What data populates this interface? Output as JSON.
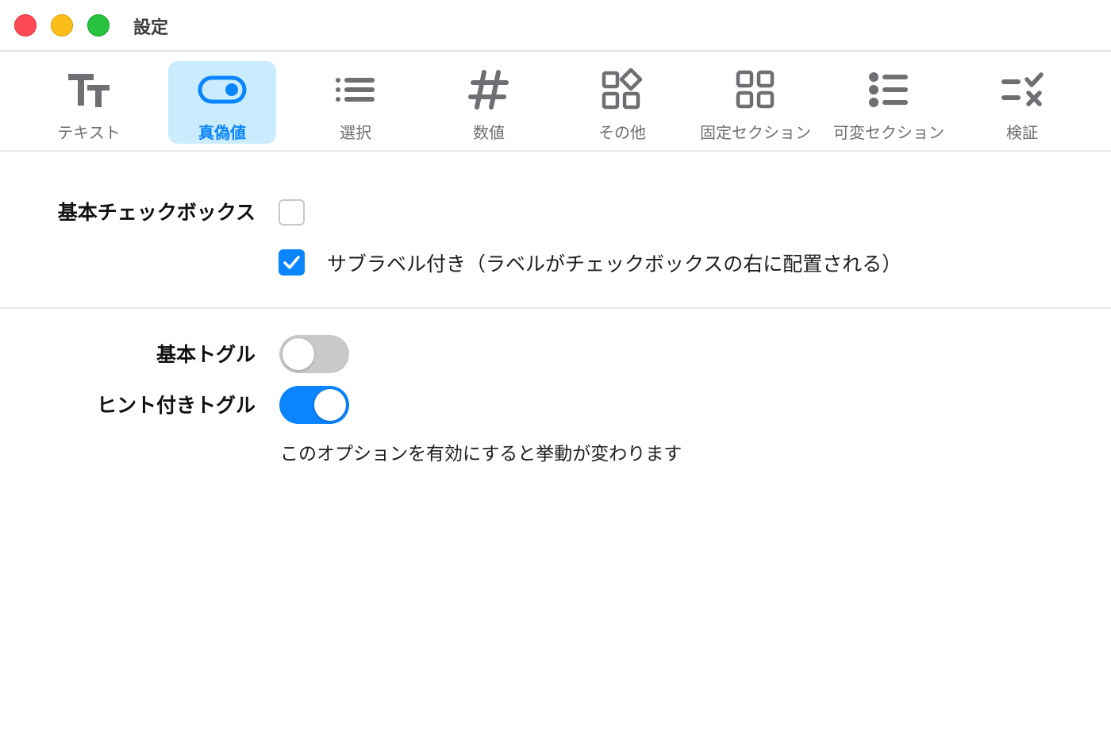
{
  "window": {
    "title": "設定"
  },
  "toolbar": {
    "items": [
      {
        "label": "テキスト",
        "icon": "text-format-icon",
        "active": false
      },
      {
        "label": "真偽値",
        "icon": "toggle-icon",
        "active": true
      },
      {
        "label": "選択",
        "icon": "list-icon",
        "active": false
      },
      {
        "label": "数値",
        "icon": "hashtag-icon",
        "active": false
      },
      {
        "label": "その他",
        "icon": "shapes-icon",
        "active": false
      },
      {
        "label": "固定セクション",
        "icon": "grid-icon",
        "active": false
      },
      {
        "label": "可変セクション",
        "icon": "bullet-list-icon",
        "active": false
      },
      {
        "label": "検証",
        "icon": "checklist-icon",
        "active": false
      }
    ]
  },
  "checkbox_section": {
    "label": "基本チェックボックス",
    "basic_checked": false,
    "sublabel_checkbox": {
      "checked": true,
      "label": "サブラベル付き（ラベルがチェックボックスの右に配置される）"
    }
  },
  "toggle_section": {
    "basic": {
      "label": "基本トグル",
      "on": false
    },
    "hinted": {
      "label": "ヒント付きトグル",
      "on": true,
      "hint": "このオプションを有効にすると挙動が変わります"
    }
  },
  "colors": {
    "accent": "#0a84ff",
    "active_tab_bg": "#cbecfe",
    "icon_gray": "#6e6e73",
    "toggle_off": "#c9c9cb",
    "close": "#fe4a57",
    "minimize": "#fcbd1b",
    "zoom": "#29c23f"
  }
}
